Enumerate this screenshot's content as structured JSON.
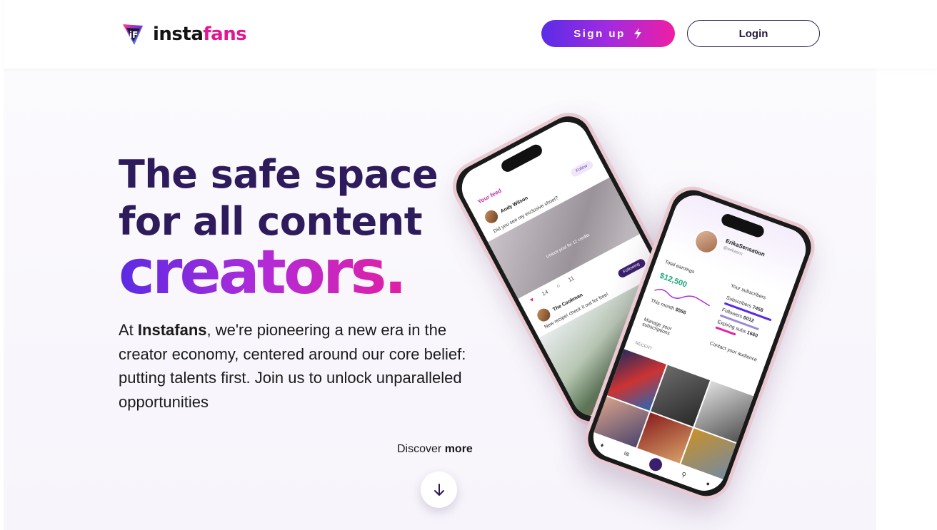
{
  "header": {
    "logo_text_a": "insta",
    "logo_text_b": "fans",
    "signup_label": "Sign up",
    "login_label": "Login"
  },
  "hero": {
    "title_line1": "The safe space",
    "title_line2": "for all content",
    "title_accent": "creators.",
    "desc_prefix": "At ",
    "desc_brand": "Instafans",
    "desc_rest": ", we're pioneering a new era in the creator economy, centered around our core belief: putting talents first. Join us to unlock unparalleled opportunities",
    "discover_prefix": "Discover ",
    "discover_bold": "more"
  },
  "phone_feed": {
    "feed_label": "Your feed",
    "post1_name": "Andy Wilson",
    "post1_follow": "Follow",
    "post1_date": "Oct. 25",
    "post1_text": "Did you see my exclusive shoot?",
    "unlock_text": "Unlock post for 12 credits",
    "post1_likes": "14",
    "post1_comments": "11",
    "post2_name": "The Cookman",
    "post2_follow": "Following",
    "post2_date": "Oct. 25",
    "post2_text": "New recipe! check it out for free!"
  },
  "phone_profile": {
    "name": "ErikaSensation",
    "handle": "@erikasns",
    "total_earnings_label": "Total earnings",
    "earnings_value": "$12,500",
    "this_month_label": "This month",
    "this_month_value": "$556",
    "subscribers_section": "Your subscribers",
    "subscribers_label": "Subscribers",
    "subscribers_value": "7458",
    "followers_label": "Followers",
    "followers_value": "6012",
    "expiring_label": "Expiring subs",
    "expiring_value": "1660",
    "manage_label": "Manage your subscriptions",
    "contact_label": "Contact your audience",
    "recent_label": "RECENT"
  },
  "colors": {
    "brand_purple": "#5a2ce6",
    "brand_pink": "#ee1ea4",
    "title_color": "#2d1b5c"
  }
}
